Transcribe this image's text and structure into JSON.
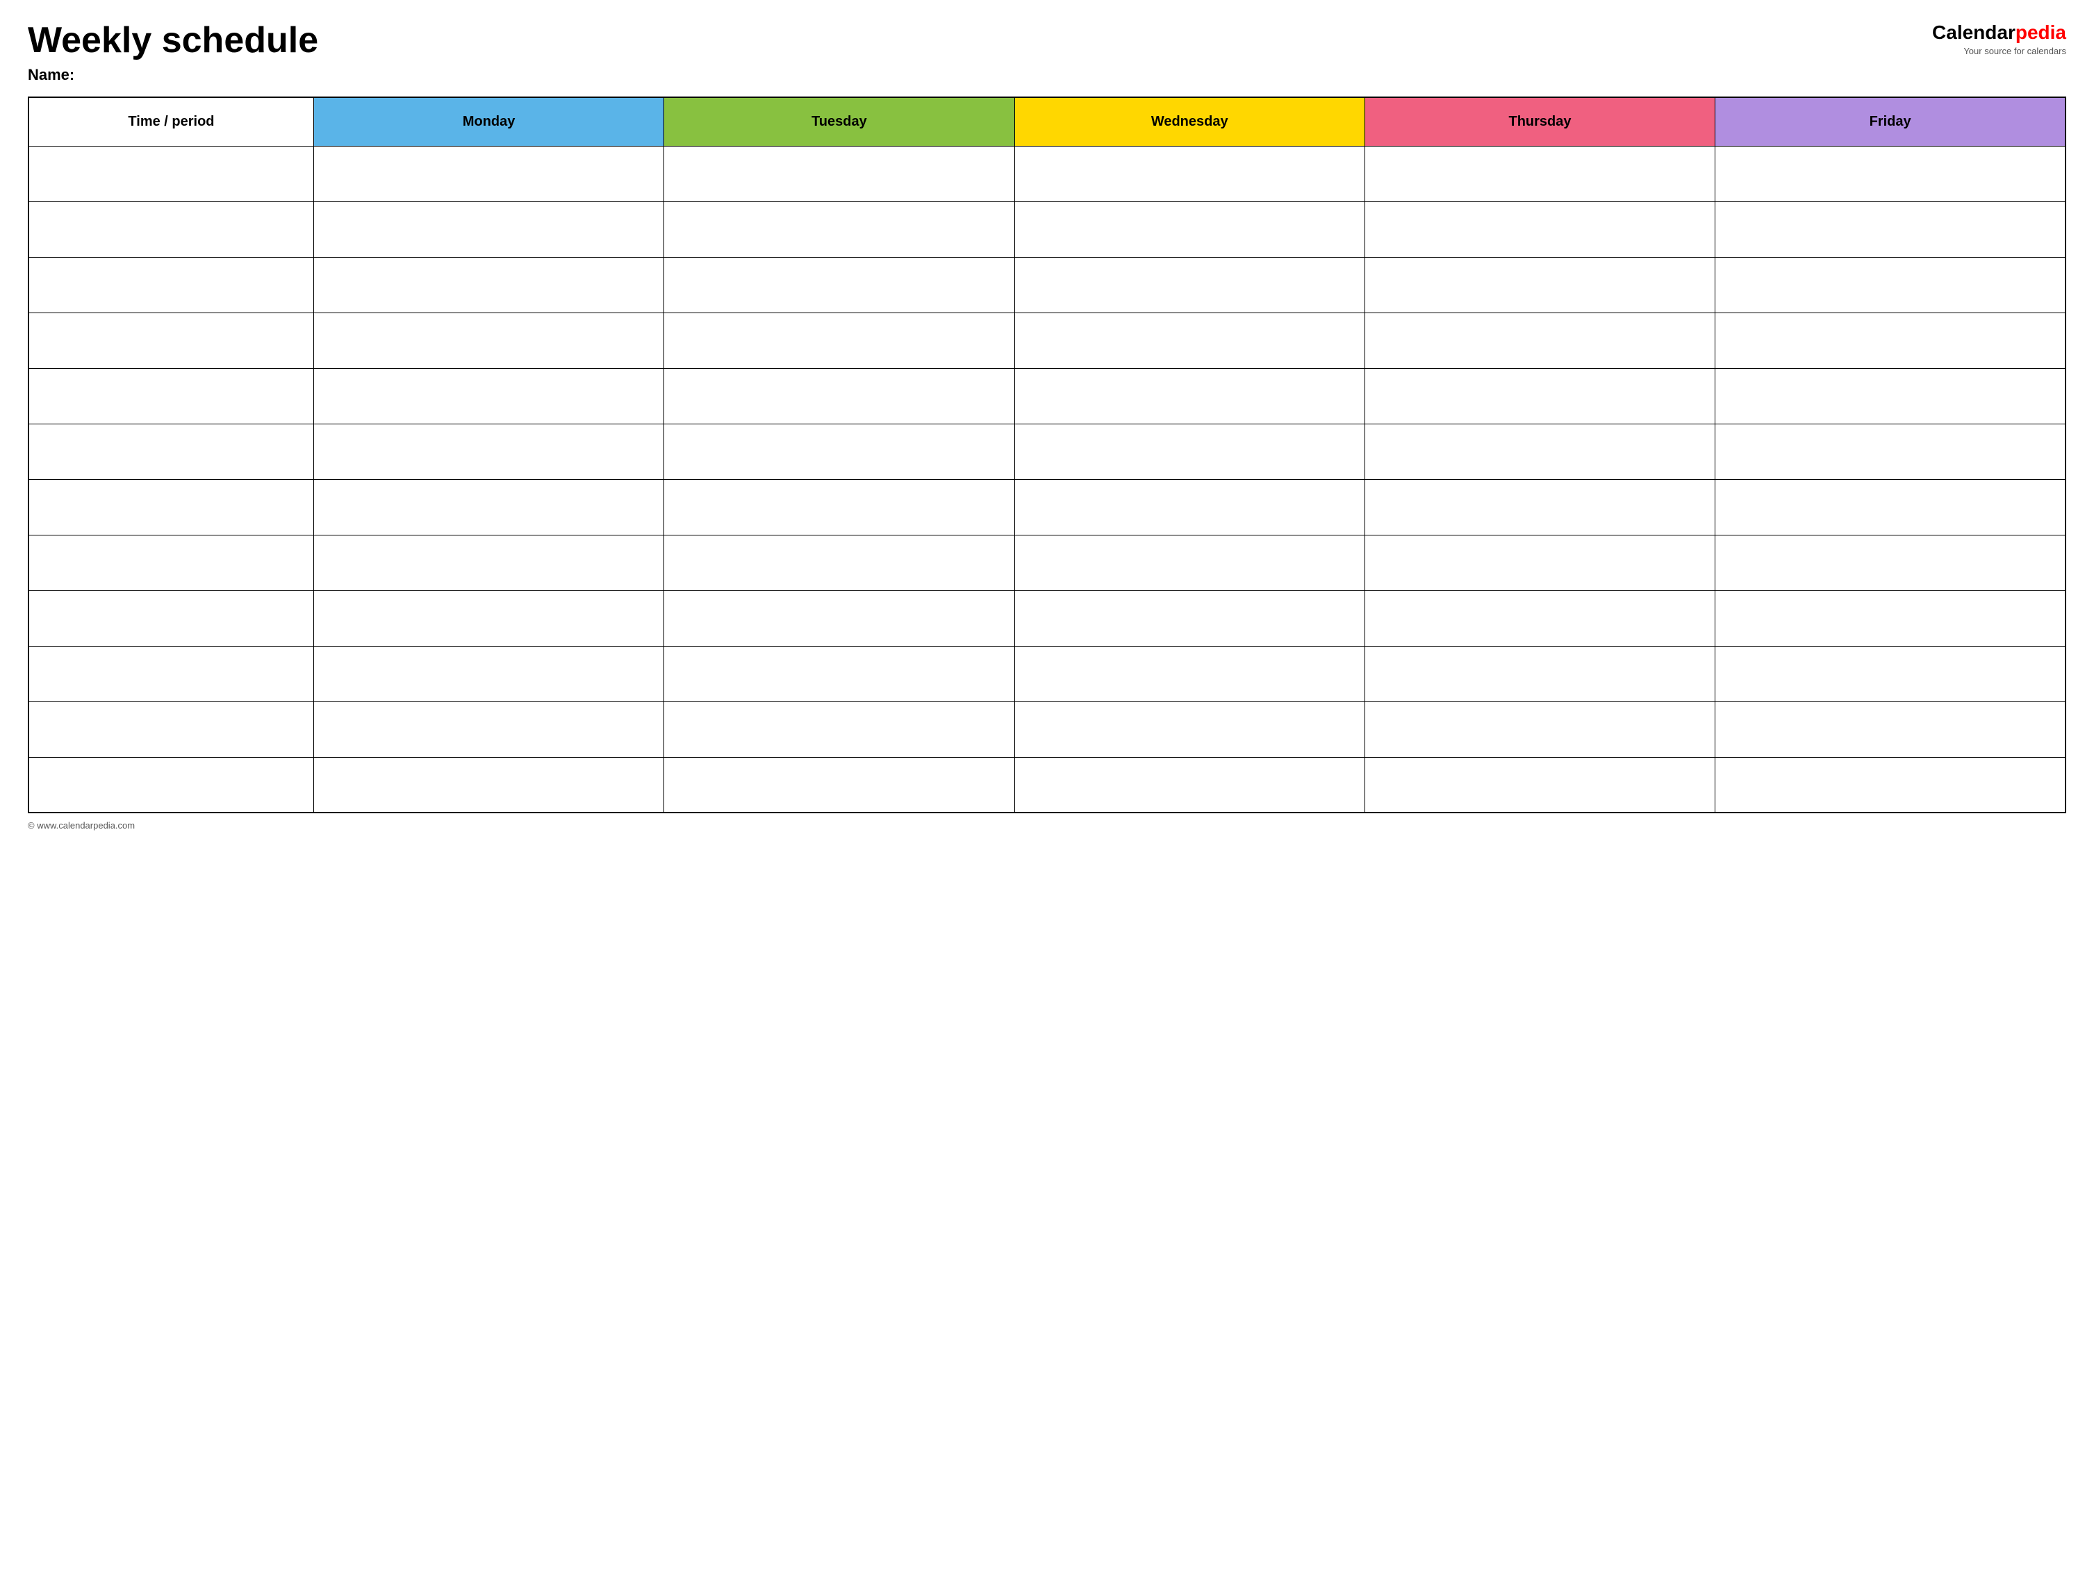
{
  "header": {
    "title": "Weekly schedule",
    "name_label": "Name:",
    "logo": {
      "brand_part1": "Calendar",
      "brand_part2": "pedia",
      "tagline": "Your source for calendars"
    }
  },
  "table": {
    "columns": [
      {
        "key": "time",
        "label": "Time / period",
        "color": "#ffffff"
      },
      {
        "key": "monday",
        "label": "Monday",
        "color": "#5ab4e8"
      },
      {
        "key": "tuesday",
        "label": "Tuesday",
        "color": "#88c140"
      },
      {
        "key": "wednesday",
        "label": "Wednesday",
        "color": "#ffd700"
      },
      {
        "key": "thursday",
        "label": "Thursday",
        "color": "#f06080"
      },
      {
        "key": "friday",
        "label": "Friday",
        "color": "#b08ee0"
      }
    ],
    "row_count": 12
  },
  "footer": {
    "url": "© www.calendarpedia.com"
  }
}
